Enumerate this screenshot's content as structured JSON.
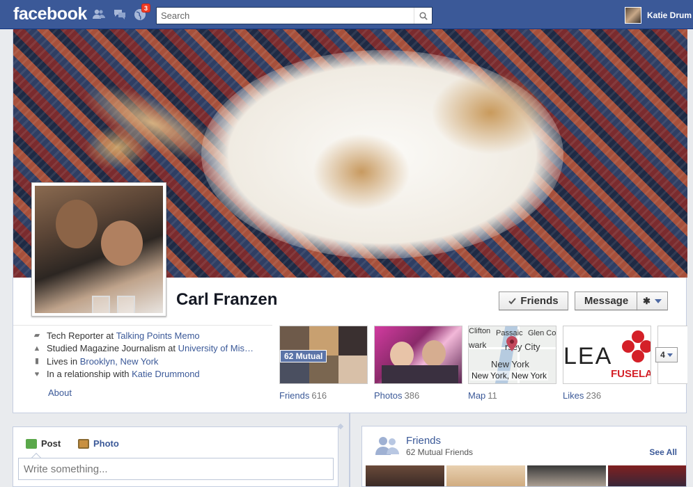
{
  "header": {
    "logo": "facebook",
    "notifications_count": "3",
    "search_placeholder": "Search",
    "user_name": "Katie Drum"
  },
  "profile": {
    "name": "Carl Franzen",
    "friends_button": "Friends",
    "message_button": "Message",
    "about": [
      {
        "icon": "briefcase-icon",
        "prefix": "Tech Reporter at ",
        "link": "Talking Points Memo"
      },
      {
        "icon": "graduation-cap-icon",
        "prefix": "Studied Magazine Journalism at ",
        "link": "University of Mis…"
      },
      {
        "icon": "city-icon",
        "prefix": "Lives in ",
        "link": "Brooklyn, New York"
      },
      {
        "icon": "heart-icon",
        "prefix": "In a relationship with ",
        "link": "Katie Drummond"
      }
    ],
    "about_link": "About",
    "tiles": {
      "friends": {
        "label": "Friends",
        "count": "616",
        "badge": "62 Mutual"
      },
      "photos": {
        "label": "Photos",
        "count": "386"
      },
      "map": {
        "label": "Map",
        "count": "11",
        "places": [
          "Clifton",
          "Passaic",
          "Glen Cov",
          "wark",
          "rsey City",
          "New York",
          "New York, New York"
        ]
      },
      "likes": {
        "label": "Likes",
        "count": "236",
        "logo_text": "LEA",
        "logo_text2": "FUSELAI"
      }
    },
    "more_count": "4"
  },
  "composer": {
    "post_tab": "Post",
    "photo_tab": "Photo",
    "placeholder": "Write something..."
  },
  "friends_box": {
    "title": "Friends",
    "subtitle": "62 Mutual Friends",
    "see_all": "See All"
  },
  "colors": {
    "brand": "#3b5998",
    "link": "#3b5998",
    "badge": "#f03d25"
  }
}
